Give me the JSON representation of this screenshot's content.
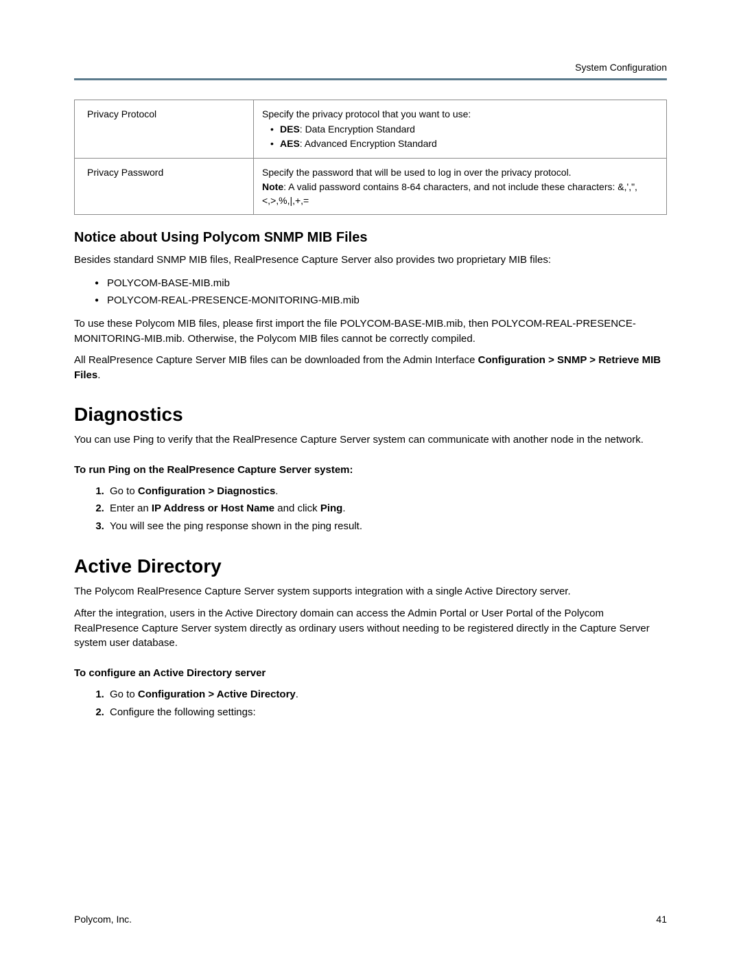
{
  "header": {
    "section": "System Configuration"
  },
  "table": {
    "rows": [
      {
        "label": "Privacy Protocol",
        "intro": "Specify the privacy protocol that you want to use:",
        "bullets": [
          {
            "bold": "DES",
            "rest": ": Data Encryption Standard"
          },
          {
            "bold": "AES",
            "rest": ": Advanced Encryption Standard"
          }
        ]
      },
      {
        "label": "Privacy Password",
        "line1": "Specify the password that will be used to log in over the privacy protocol.",
        "noteBold": "Note",
        "noteRest": ": A valid password contains 8-64 characters, and not include these characters: &,',\",<,>,%,|,+,="
      }
    ]
  },
  "mib": {
    "heading": "Notice about Using Polycom SNMP MIB Files",
    "p1": "Besides standard SNMP MIB files, RealPresence Capture Server also provides two proprietary MIB files:",
    "files": [
      "POLYCOM-BASE-MIB.mib",
      "POLYCOM-REAL-PRESENCE-MONITORING-MIB.mib"
    ],
    "p2": "To use these Polycom MIB files, please first import the file POLYCOM-BASE-MIB.mib, then POLYCOM-REAL-PRESENCE-MONITORING-MIB.mib. Otherwise, the Polycom MIB files cannot be correctly compiled.",
    "p3a": "All RealPresence Capture Server MIB files can be downloaded from the Admin Interface ",
    "p3bold": "Configuration > SNMP > Retrieve MIB Files",
    "p3b": "."
  },
  "diag": {
    "heading": "Diagnostics",
    "p1": "You can use Ping to verify that the RealPresence Capture Server system can communicate with another node in the network.",
    "task": "To run Ping on the RealPresence Capture Server system:",
    "steps": {
      "s1a": "Go to ",
      "s1bold": "Configuration > Diagnostics",
      "s1b": ".",
      "s2a": "Enter an ",
      "s2bold1": "IP Address or Host Name",
      "s2mid": " and click ",
      "s2bold2": "Ping",
      "s2b": ".",
      "s3": "You will see the ping response shown in the ping result."
    }
  },
  "ad": {
    "heading": "Active Directory",
    "p1": "The Polycom RealPresence Capture Server system supports integration with a single Active Directory server.",
    "p2": "After the integration, users in the Active Directory domain can access the Admin Portal or User Portal of the Polycom RealPresence Capture Server system directly as ordinary users without needing to be registered directly in the Capture Server system user database.",
    "task": "To configure an Active Directory server",
    "steps": {
      "s1a": "Go to ",
      "s1bold": "Configuration > Active Directory",
      "s1b": ".",
      "s2": "Configure the following settings:"
    }
  },
  "footer": {
    "company": "Polycom, Inc.",
    "page": "41"
  }
}
